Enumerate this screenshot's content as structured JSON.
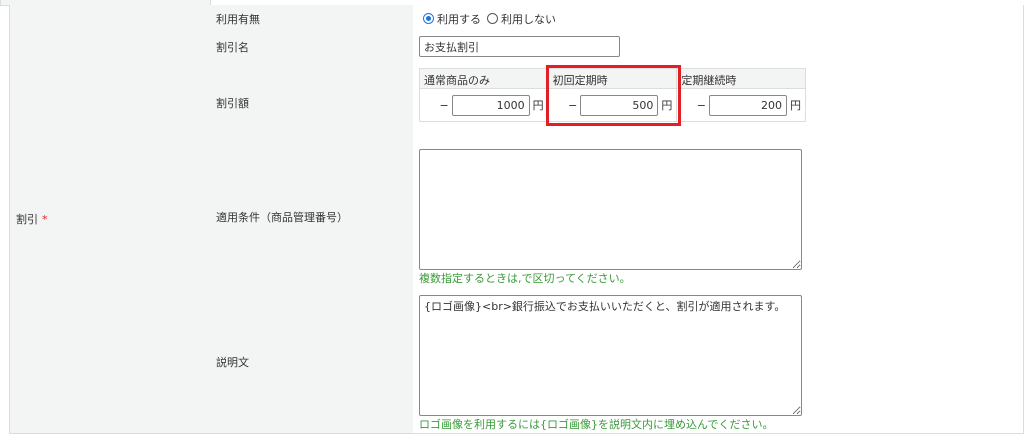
{
  "section_label": "割引",
  "required_mark": "*",
  "rows": {
    "usage": {
      "label": "利用有無",
      "options": [
        {
          "label": "利用する",
          "selected": true
        },
        {
          "label": "利用しない",
          "selected": false
        }
      ]
    },
    "name": {
      "label": "割引名",
      "value": "お支払割引"
    },
    "amount": {
      "label": "割引額",
      "prefix": "−",
      "unit": "円",
      "columns": [
        {
          "header": "通常商品のみ",
          "value": "1000"
        },
        {
          "header": "初回定期時",
          "value": "500"
        },
        {
          "header": "定期継続時",
          "value": "200"
        }
      ]
    },
    "conditions": {
      "label": "適用条件（商品管理番号）",
      "value": "",
      "note": "複数指定するときは,で区切ってください。"
    },
    "description": {
      "label": "説明文",
      "value": "{ロゴ画像}<br>銀行振込でお支払いいただくと、割引が適用されます。",
      "note": "ロゴ画像を利用するには{ロゴ画像}を説明文内に埋め込んでください。"
    }
  },
  "colors": {
    "highlight": "#e31e25",
    "note": "#3a9a3a",
    "label_bg": "#f3f4f4"
  }
}
